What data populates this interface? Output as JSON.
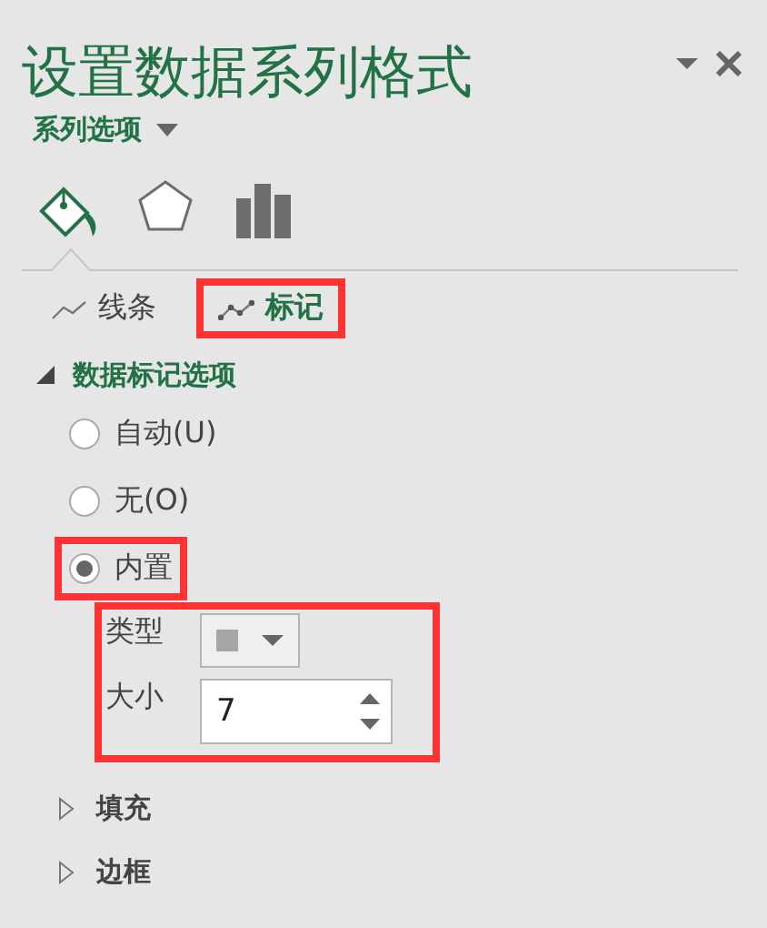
{
  "pane": {
    "title": "设置数据系列格式",
    "options_menu": "系列选项"
  },
  "category_icons": [
    {
      "kind": "fill",
      "selected": true
    },
    {
      "kind": "effects",
      "selected": false
    },
    {
      "kind": "series",
      "selected": false
    }
  ],
  "tabs": [
    {
      "label": "线条",
      "selected": false,
      "highlighted": false
    },
    {
      "label": "标记",
      "selected": true,
      "highlighted": true
    }
  ],
  "marker_section": {
    "title": "数据标记选项",
    "expanded": true,
    "options": [
      {
        "label": "自动(U)",
        "selected": false,
        "highlighted": false
      },
      {
        "label": "无(O)",
        "selected": false,
        "highlighted": false
      },
      {
        "label": "内置",
        "selected": true,
        "highlighted": true
      }
    ],
    "builtin": {
      "highlighted": true,
      "type_label": "类型",
      "type_swatch": {
        "color": "#a6a6a6"
      },
      "size_label": "大小",
      "size_value": "7"
    }
  },
  "collapsed_sections": [
    {
      "title": "填充",
      "expanded": false
    },
    {
      "title": "边框",
      "expanded": false
    }
  ]
}
